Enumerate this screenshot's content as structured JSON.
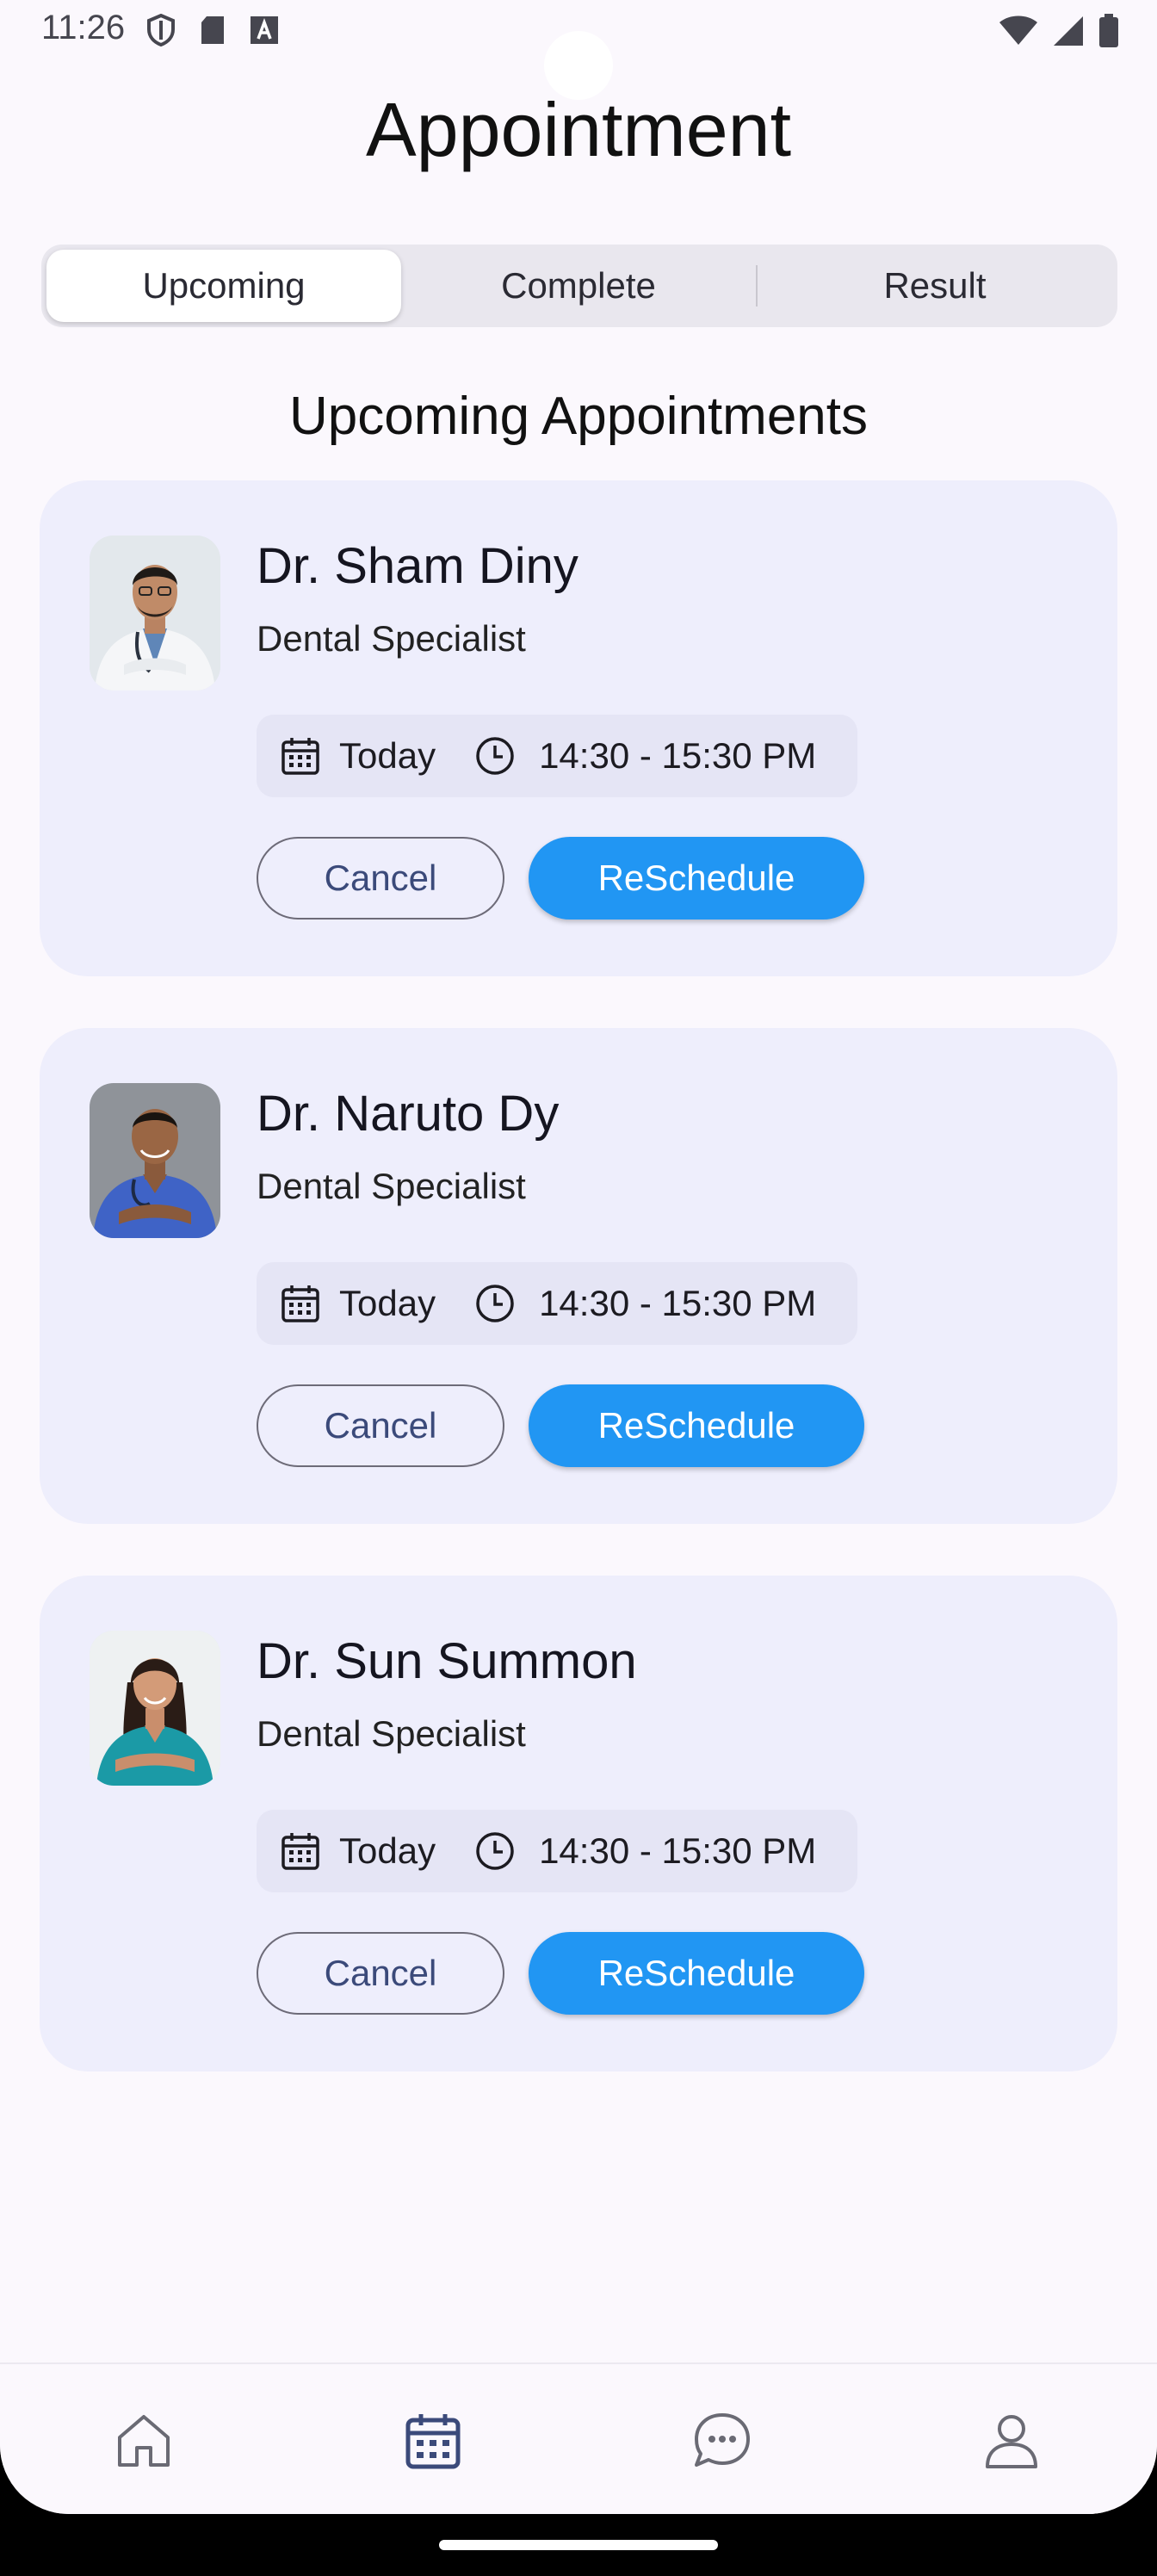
{
  "status_bar": {
    "time": "11:26"
  },
  "header": {
    "title": "Appointment"
  },
  "tabs": [
    {
      "label": "Upcoming",
      "active": true
    },
    {
      "label": "Complete",
      "active": false
    },
    {
      "label": "Result",
      "active": false
    }
  ],
  "section": {
    "title": "Upcoming Appointments"
  },
  "appointments": [
    {
      "doctor": "Dr. Sham Diny",
      "specialty": "Dental Specialist",
      "date": "Today",
      "time": "14:30 - 15:30 PM",
      "cancel_label": "Cancel",
      "reschedule_label": "ReSchedule"
    },
    {
      "doctor": "Dr. Naruto Dy",
      "specialty": "Dental Specialist",
      "date": "Today",
      "time": "14:30 - 15:30 PM",
      "cancel_label": "Cancel",
      "reschedule_label": "ReSchedule"
    },
    {
      "doctor": "Dr. Sun Summon",
      "specialty": "Dental Specialist",
      "date": "Today",
      "time": "14:30 - 15:30 PM",
      "cancel_label": "Cancel",
      "reschedule_label": "ReSchedule"
    }
  ],
  "bottom_nav": [
    {
      "icon": "home-icon",
      "active": false
    },
    {
      "icon": "calendar-icon",
      "active": true
    },
    {
      "icon": "chat-icon",
      "active": false
    },
    {
      "icon": "profile-icon",
      "active": false
    }
  ],
  "colors": {
    "accent": "#2196f3",
    "card_bg": "#eeeefc",
    "background": "#fbf8fd",
    "active_nav": "#3b4a7a"
  }
}
